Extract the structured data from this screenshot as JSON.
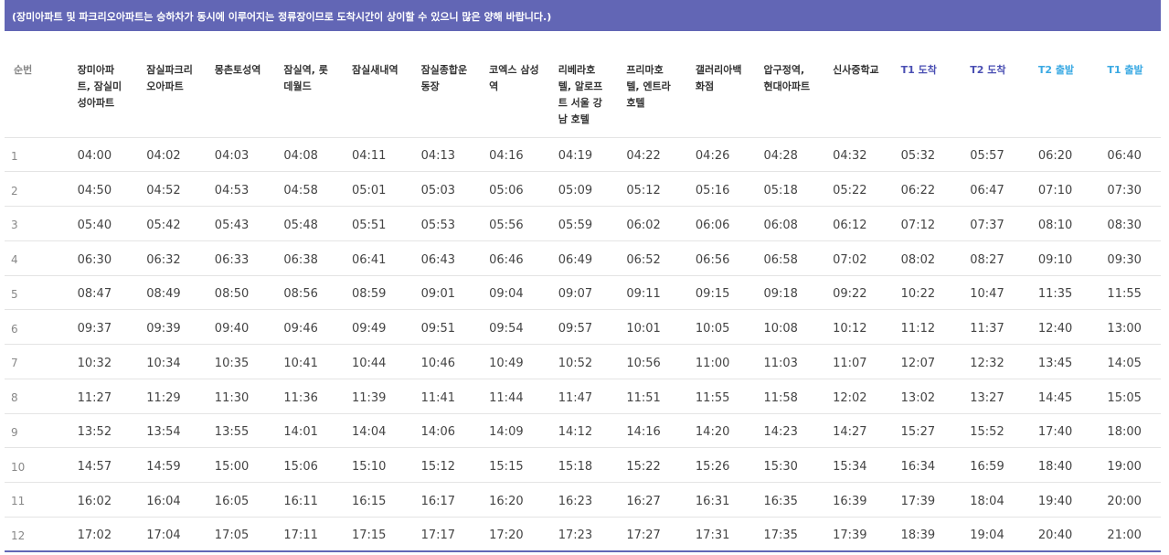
{
  "notice": "(장미아파트 및 파크리오아파트는 승하차가 동시에 이루어지는 정류장이므로 도착시간이 상이할 수 있으니 많은 양해 바랍니다.)",
  "columns": [
    "순번",
    "장미아파\n트, 잠실미\n성아파트",
    "잠실파크리\n오아파트",
    "몽촌토성역",
    "잠실역, 롯\n데월드",
    "잠실새내역",
    "잠실종합운\n동장",
    "코엑스 삼성\n역",
    "리베라호\n텔, 알로프\n트 서울 강\n남 호텔",
    "프리마호\n텔, 엔트라\n호텔",
    "갤러리아백\n화점",
    "압구정역,\n현대아파트",
    "신사중학교",
    "T1 도착",
    "T2 도착",
    "T2 출발",
    "T1 출발"
  ],
  "rows": [
    [
      "1",
      "04:00",
      "04:02",
      "04:03",
      "04:08",
      "04:11",
      "04:13",
      "04:16",
      "04:19",
      "04:22",
      "04:26",
      "04:28",
      "04:32",
      "05:32",
      "05:57",
      "06:20",
      "06:40"
    ],
    [
      "2",
      "04:50",
      "04:52",
      "04:53",
      "04:58",
      "05:01",
      "05:03",
      "05:06",
      "05:09",
      "05:12",
      "05:16",
      "05:18",
      "05:22",
      "06:22",
      "06:47",
      "07:10",
      "07:30"
    ],
    [
      "3",
      "05:40",
      "05:42",
      "05:43",
      "05:48",
      "05:51",
      "05:53",
      "05:56",
      "05:59",
      "06:02",
      "06:06",
      "06:08",
      "06:12",
      "07:12",
      "07:37",
      "08:10",
      "08:30"
    ],
    [
      "4",
      "06:30",
      "06:32",
      "06:33",
      "06:38",
      "06:41",
      "06:43",
      "06:46",
      "06:49",
      "06:52",
      "06:56",
      "06:58",
      "07:02",
      "08:02",
      "08:27",
      "09:10",
      "09:30"
    ],
    [
      "5",
      "08:47",
      "08:49",
      "08:50",
      "08:56",
      "08:59",
      "09:01",
      "09:04",
      "09:07",
      "09:11",
      "09:15",
      "09:18",
      "09:22",
      "10:22",
      "10:47",
      "11:35",
      "11:55"
    ],
    [
      "6",
      "09:37",
      "09:39",
      "09:40",
      "09:46",
      "09:49",
      "09:51",
      "09:54",
      "09:57",
      "10:01",
      "10:05",
      "10:08",
      "10:12",
      "11:12",
      "11:37",
      "12:40",
      "13:00"
    ],
    [
      "7",
      "10:32",
      "10:34",
      "10:35",
      "10:41",
      "10:44",
      "10:46",
      "10:49",
      "10:52",
      "10:56",
      "11:00",
      "11:03",
      "11:07",
      "12:07",
      "12:32",
      "13:45",
      "14:05"
    ],
    [
      "8",
      "11:27",
      "11:29",
      "11:30",
      "11:36",
      "11:39",
      "11:41",
      "11:44",
      "11:47",
      "11:51",
      "11:55",
      "11:58",
      "12:02",
      "13:02",
      "13:27",
      "14:45",
      "15:05"
    ],
    [
      "9",
      "13:52",
      "13:54",
      "13:55",
      "14:01",
      "14:04",
      "14:06",
      "14:09",
      "14:12",
      "14:16",
      "14:20",
      "14:23",
      "14:27",
      "15:27",
      "15:52",
      "17:40",
      "18:00"
    ],
    [
      "10",
      "14:57",
      "14:59",
      "15:00",
      "15:06",
      "15:10",
      "15:12",
      "15:15",
      "15:18",
      "15:22",
      "15:26",
      "15:30",
      "15:34",
      "16:34",
      "16:59",
      "18:40",
      "19:00"
    ],
    [
      "11",
      "16:02",
      "16:04",
      "16:05",
      "16:11",
      "16:15",
      "16:17",
      "16:20",
      "16:23",
      "16:27",
      "16:31",
      "16:35",
      "16:39",
      "17:39",
      "18:04",
      "19:40",
      "20:00"
    ],
    [
      "12",
      "17:02",
      "17:04",
      "17:05",
      "17:11",
      "17:15",
      "17:17",
      "17:20",
      "17:23",
      "17:27",
      "17:31",
      "17:35",
      "17:39",
      "18:39",
      "19:04",
      "20:40",
      "21:00"
    ]
  ],
  "colors": {
    "notice_bg": "#6266b5",
    "arrival_header": "#4a4fb3",
    "departure_header": "#3aa9e3"
  }
}
